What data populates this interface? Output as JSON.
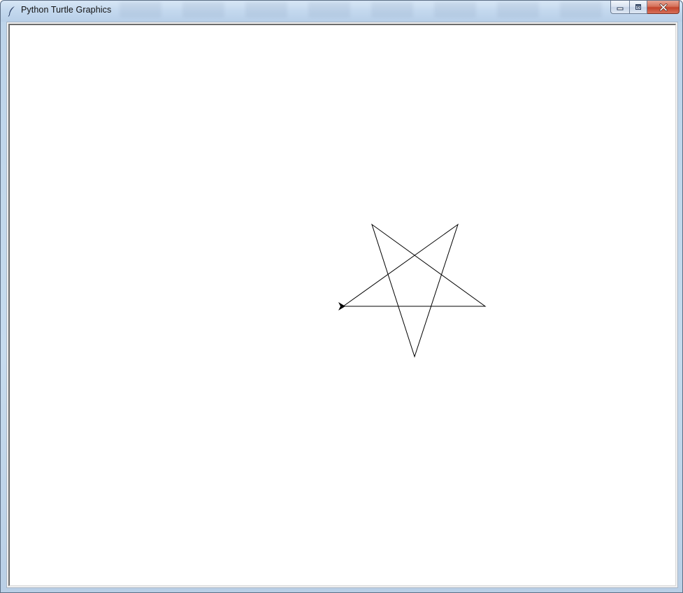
{
  "window": {
    "title": "Python Turtle Graphics",
    "app_icon": "feather-icon",
    "controls": {
      "minimize": "minimize-icon",
      "maximize": "maximize-icon",
      "close": "close-icon"
    }
  },
  "canvas": {
    "background": "#ffffff",
    "pen_color": "#000000",
    "turtle_shape": "classic",
    "turtle_color": "#000000",
    "turtle_heading": "east"
  }
}
